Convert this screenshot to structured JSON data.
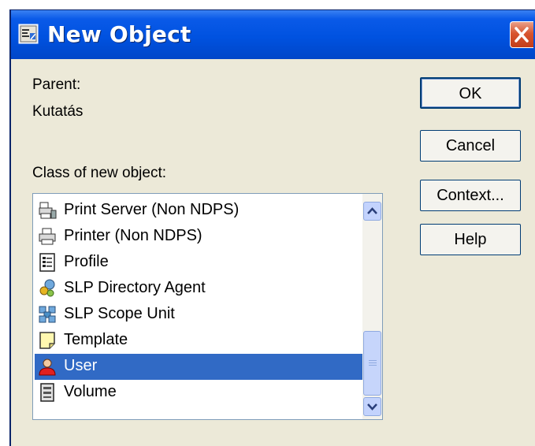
{
  "window": {
    "title": "New Object"
  },
  "parent": {
    "label": "Parent:",
    "value": "Kutatás"
  },
  "class_label": "Class of new object:",
  "buttons": {
    "ok": "OK",
    "cancel": "Cancel",
    "context": "Context...",
    "help": "Help"
  },
  "list": {
    "items": [
      {
        "label": "Print Server (Non NDPS)",
        "icon": "print-server-icon",
        "selected": false
      },
      {
        "label": "Printer (Non NDPS)",
        "icon": "printer-icon",
        "selected": false
      },
      {
        "label": "Profile",
        "icon": "profile-icon",
        "selected": false
      },
      {
        "label": "SLP Directory Agent",
        "icon": "slp-directory-agent-icon",
        "selected": false
      },
      {
        "label": "SLP Scope Unit",
        "icon": "slp-scope-unit-icon",
        "selected": false
      },
      {
        "label": "Template",
        "icon": "template-icon",
        "selected": false
      },
      {
        "label": "User",
        "icon": "user-icon",
        "selected": true
      },
      {
        "label": "Volume",
        "icon": "volume-icon",
        "selected": false
      }
    ]
  },
  "colors": {
    "title_bar": "#0052e0",
    "selection": "#316ac5",
    "dialog_bg": "#ece9d8",
    "close_button": "#d8552f"
  }
}
